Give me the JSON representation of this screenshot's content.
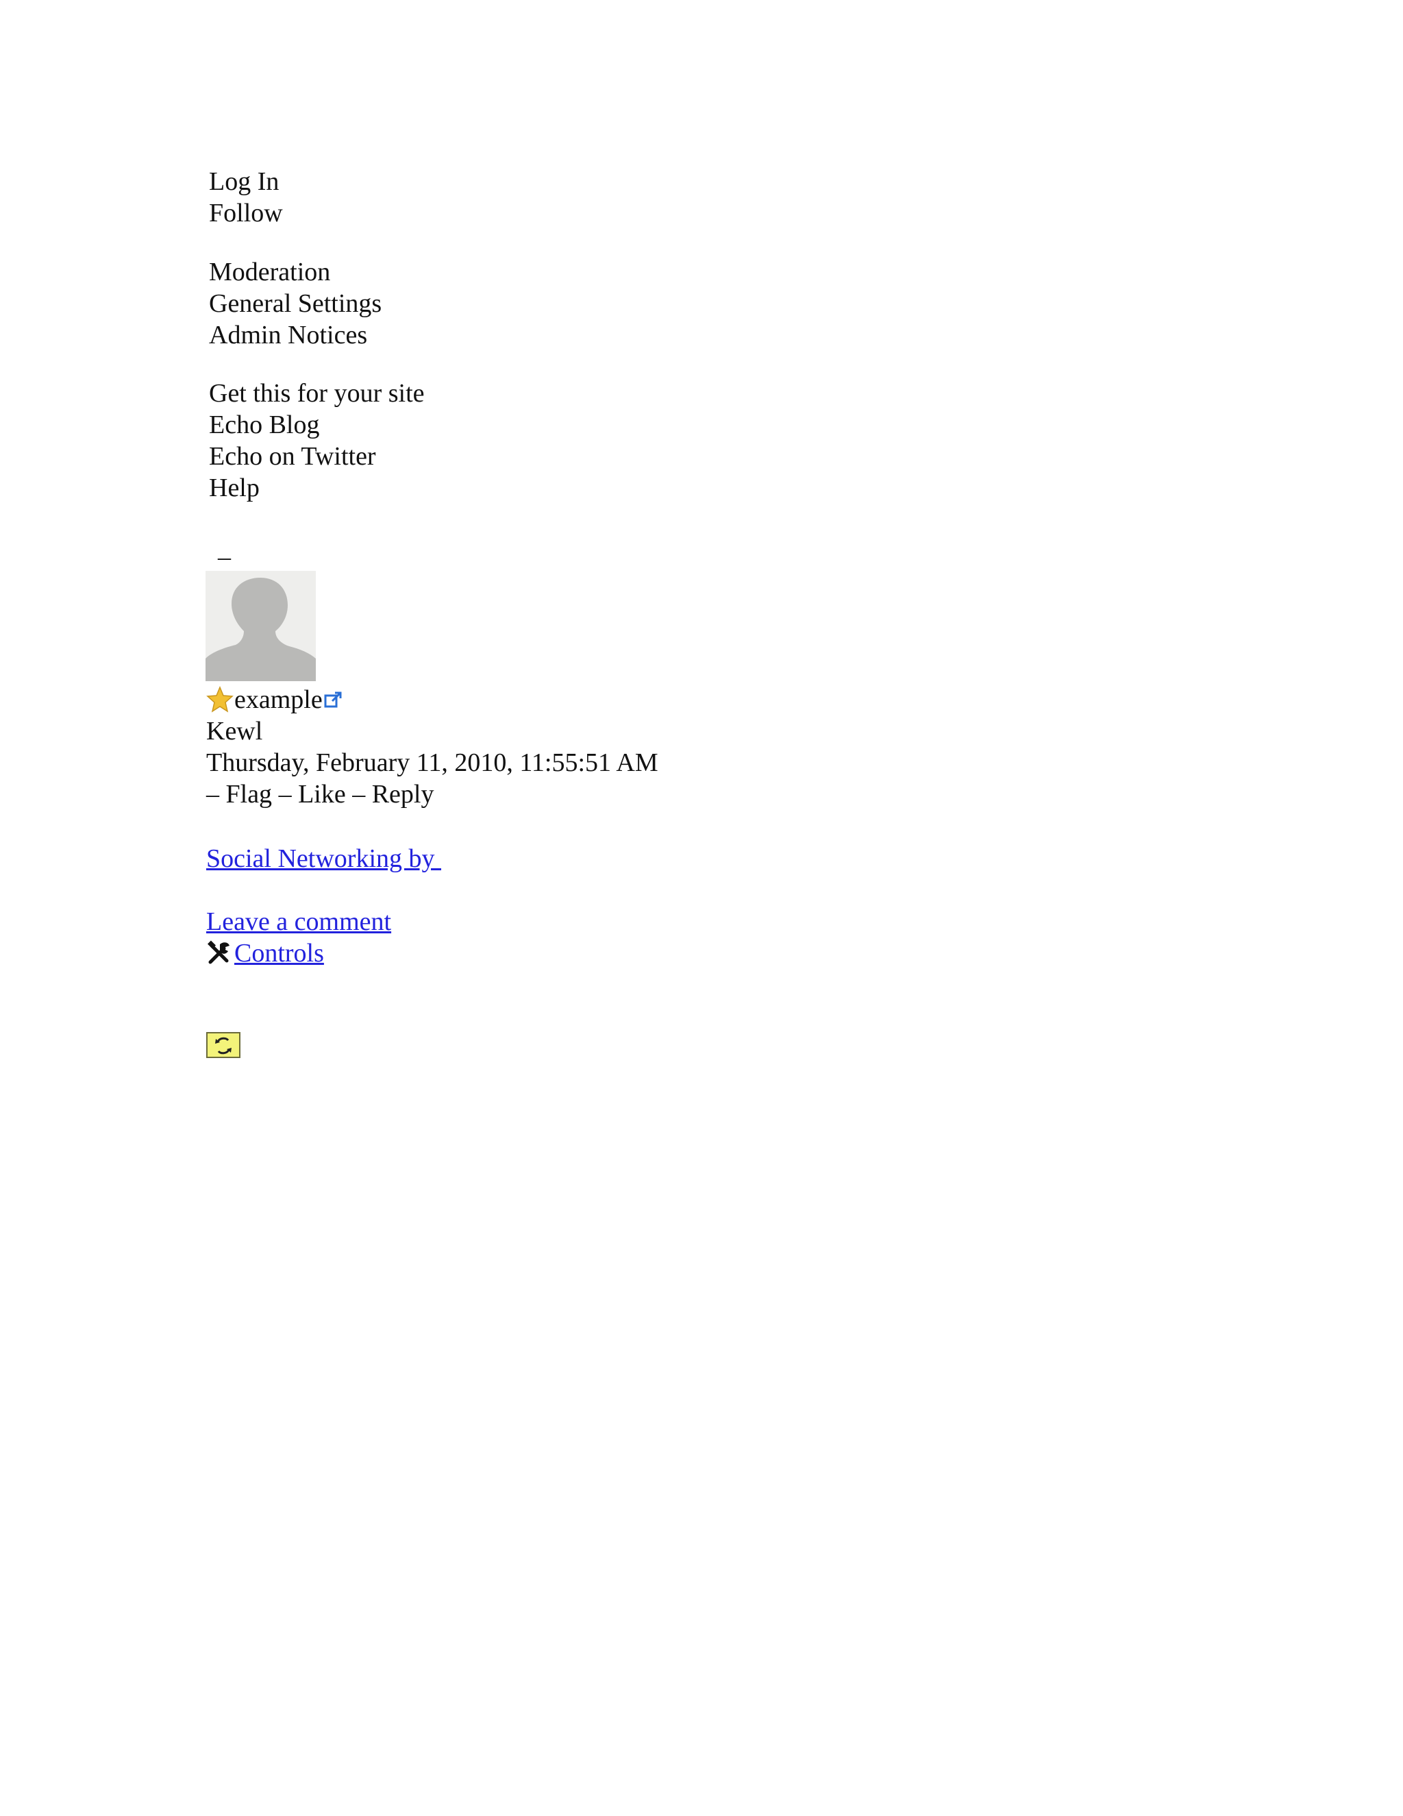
{
  "auth_menu": {
    "login": "Log In",
    "follow": "Follow"
  },
  "admin_menu": {
    "moderation": "Moderation",
    "general_settings": "General Settings",
    "admin_notices": "Admin Notices"
  },
  "info_menu": {
    "get_this": "Get this for your site",
    "echo_blog": "Echo Blog",
    "echo_twitter": "Echo on Twitter",
    "help": "Help"
  },
  "separator": "–",
  "comment": {
    "author": "example",
    "text": "Kewl",
    "timestamp": "Thursday, February 11, 2010, 11:55:51 AM",
    "actions": {
      "prefix_dash": "–",
      "flag": "Flag",
      "dash1": "–",
      "like": "Like",
      "dash2": "–",
      "reply": "Reply"
    },
    "icons": {
      "badge": "star-icon",
      "profile_link": "external-link-icon",
      "avatar": "avatar-silhouette"
    }
  },
  "footer": {
    "social_link": "Social Networking by ",
    "leave_comment": "Leave a comment",
    "controls": "Controls",
    "controls_icon": "tools-icon",
    "refresh_icon": "refresh-icon"
  },
  "colors": {
    "link": "#2222dd",
    "text": "#111111",
    "star": "#f2c033",
    "refresh_bg": "#f3f37a"
  }
}
